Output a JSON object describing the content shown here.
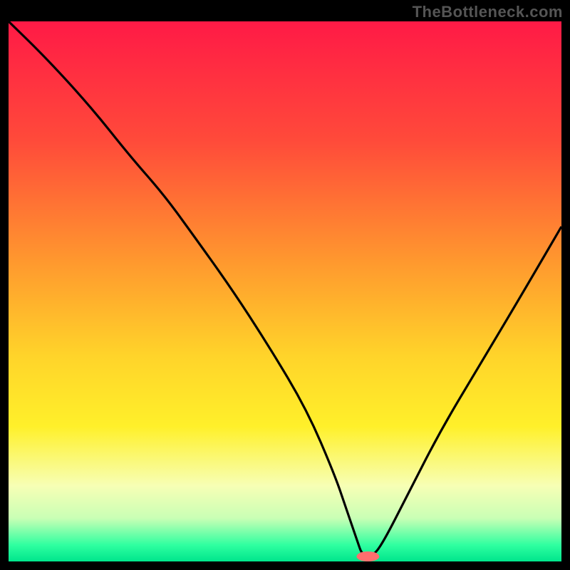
{
  "watermark": "TheBottleneck.com",
  "chart_data": {
    "type": "line",
    "title": "",
    "xlabel": "",
    "ylabel": "",
    "xlim": [
      0,
      100
    ],
    "ylim": [
      0,
      100
    ],
    "grid": false,
    "legend": false,
    "gradient_stops": [
      {
        "pct": 0,
        "color": "#ff1a46"
      },
      {
        "pct": 22,
        "color": "#ff4a3a"
      },
      {
        "pct": 45,
        "color": "#ff9a2e"
      },
      {
        "pct": 62,
        "color": "#ffd42a"
      },
      {
        "pct": 75,
        "color": "#fff02a"
      },
      {
        "pct": 86,
        "color": "#f7ffb5"
      },
      {
        "pct": 92,
        "color": "#c9ffb5"
      },
      {
        "pct": 97,
        "color": "#2effa0"
      },
      {
        "pct": 100,
        "color": "#00e58c"
      }
    ],
    "series": [
      {
        "name": "bottleneck-curve",
        "x": [
          0,
          7,
          15,
          22,
          28,
          33,
          40,
          47,
          54,
          59,
          61,
          63,
          64,
          66,
          68,
          72,
          78,
          85,
          92,
          100
        ],
        "values": [
          100,
          93,
          84,
          75,
          68,
          61,
          51,
          40,
          28,
          16,
          10,
          4,
          1,
          1,
          4,
          12,
          24,
          36,
          48,
          62
        ]
      }
    ],
    "marker": {
      "name": "optimal-point",
      "x": 65,
      "y": 0,
      "color": "#ff6e6e",
      "rx": 16,
      "ry": 7
    }
  }
}
